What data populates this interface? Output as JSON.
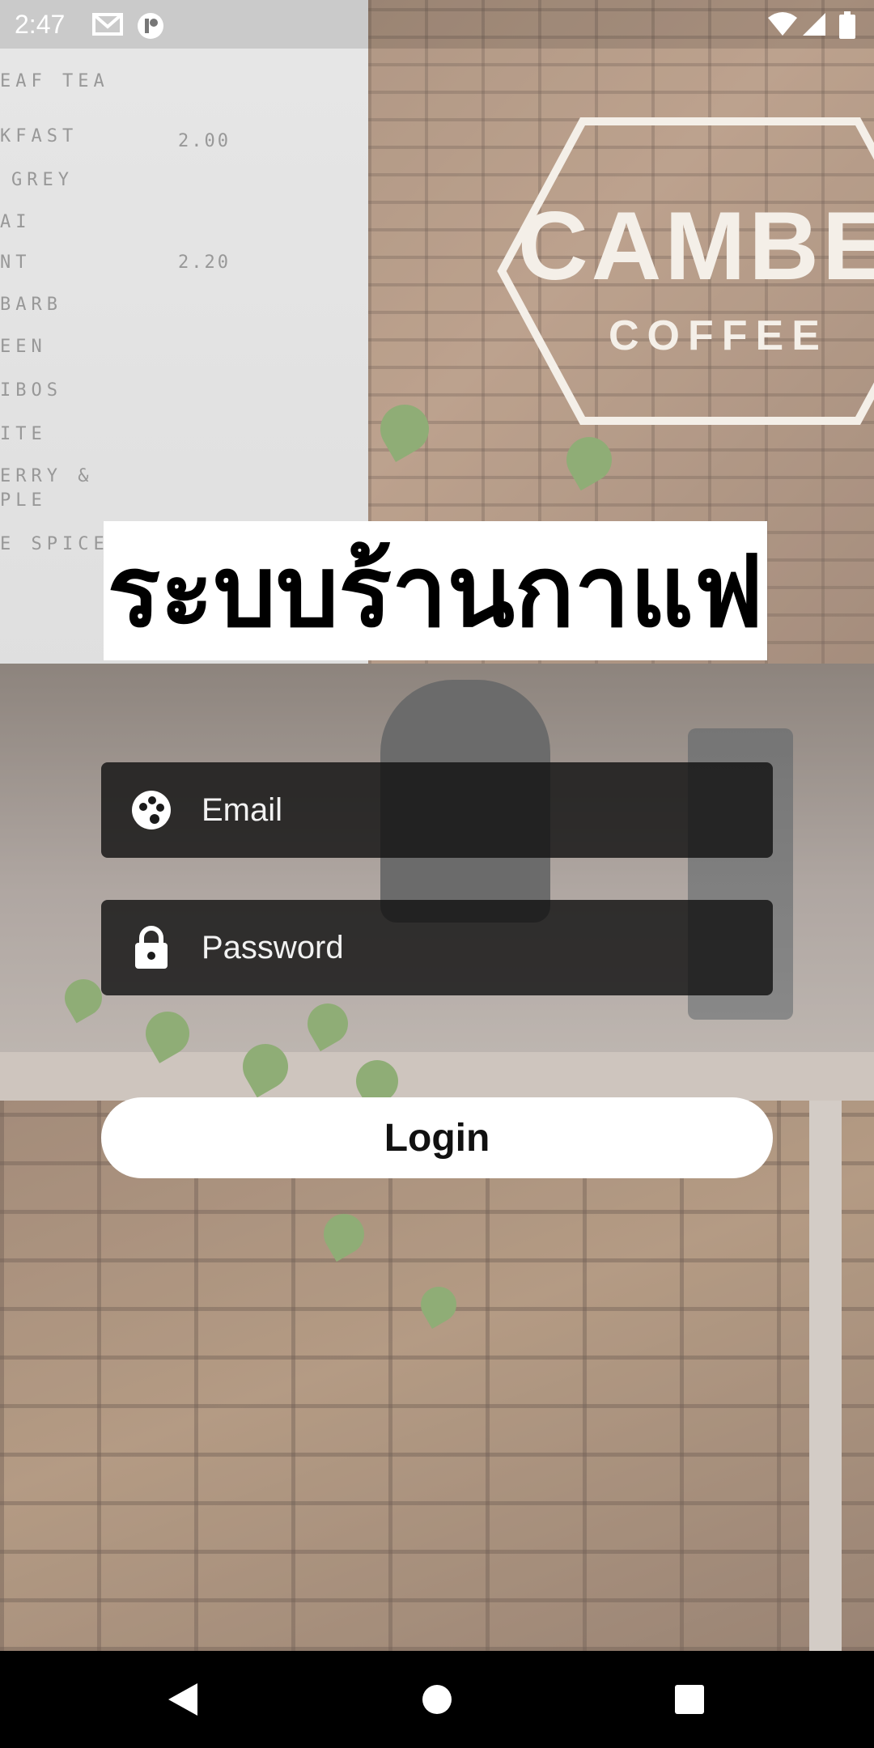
{
  "status_bar": {
    "time": "2:47",
    "icons": [
      "gmail-icon",
      "app-notification-icon",
      "wifi-icon",
      "signal-icon",
      "battery-icon"
    ]
  },
  "background": {
    "scene": "coffee-shop-photo",
    "logo": {
      "main": "CAMBER",
      "sub": "COFFEE"
    },
    "menu_board": {
      "lines": [
        "EAF TEA",
        "KFAST",
        "GREY",
        "AI",
        "NT",
        "BARB",
        "EEN",
        "IBOS",
        "ITE",
        "ERRY &",
        "PLE",
        "E SPICE"
      ],
      "prices": [
        "2.00",
        "2.20"
      ]
    }
  },
  "title": "ระบบร้านกาแฟ",
  "form": {
    "email": {
      "placeholder": "Email",
      "value": "",
      "icon": "palette-icon"
    },
    "password": {
      "placeholder": "Password",
      "value": "",
      "icon": "lock-icon"
    },
    "login_label": "Login"
  },
  "nav_bar": {
    "buttons": [
      "back-icon",
      "home-icon",
      "recents-icon"
    ]
  },
  "colors": {
    "field_background": "#121212",
    "text_on_field": "#ffffff",
    "button_background": "#ffffff",
    "button_text": "#111111",
    "title_background": "#ffffff",
    "title_text": "#000000"
  }
}
